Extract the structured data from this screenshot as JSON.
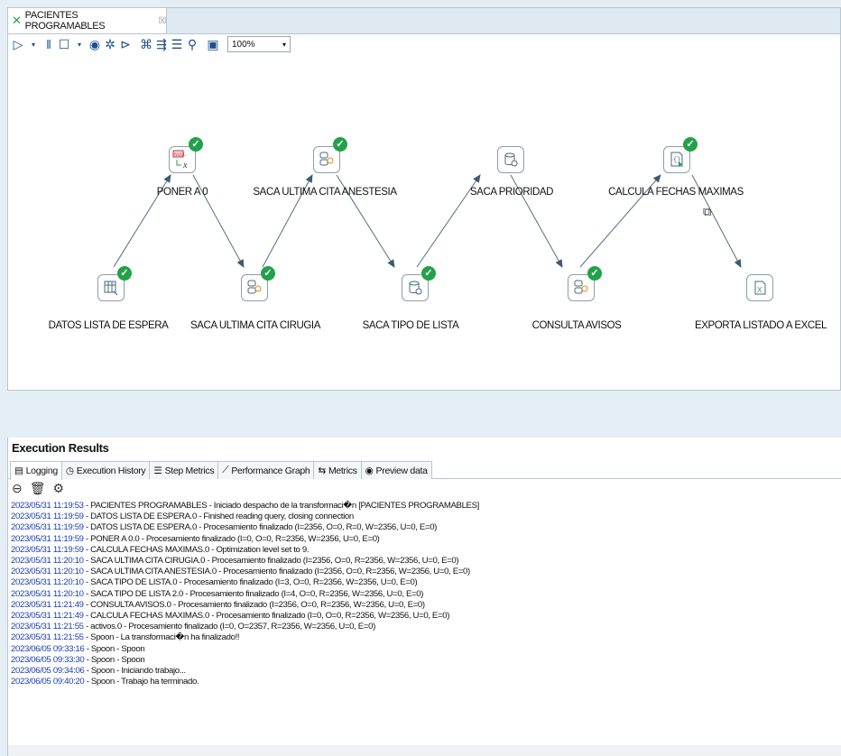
{
  "tab": {
    "title": "PACIENTES PROGRAMABLES",
    "close": "☒",
    "icon": "transformation-icon"
  },
  "toolbar": {
    "zoom": "100%"
  },
  "steps": {
    "datos_lista": "DATOS LISTA DE ESPERA",
    "poner_a0": "PONER A 0",
    "cita_cirugia": "SACA ULTIMA CITA CIRUGIA",
    "cita_anestesia": "SACA ULTIMA CITA ANESTESIA",
    "tipo_lista": "SACA TIPO DE LISTA",
    "prioridad": "SACA PRIORIDAD",
    "consulta_avisos": "CONSULTA AVISOS",
    "fechas_maximas": "CALCULA FECHAS MAXIMAS",
    "exporta_excel": "EXPORTA LISTADO A EXCEL"
  },
  "colors": {
    "success": "#23a14a",
    "timestamp": "#1a3fb0",
    "hop": "#3d5a72"
  },
  "results": {
    "title": "Execution Results",
    "tabs": [
      "Logging",
      "Execution History",
      "Step Metrics",
      "Performance Graph",
      "Metrics",
      "Preview data"
    ]
  },
  "log": [
    {
      "ts": "2023/05/31 11:19:53",
      "msg": " - PACIENTES PROGRAMABLES - Iniciado despacho de la transformaci�n [PACIENTES PROGRAMABLES]"
    },
    {
      "ts": "2023/05/31 11:19:59",
      "msg": " - DATOS LISTA DE ESPERA.0 - Finished reading query, closing connection"
    },
    {
      "ts": "2023/05/31 11:19:59",
      "msg": " - DATOS LISTA DE ESPERA.0 - Procesamiento finalizado (I=2356, O=0, R=0, W=2356, U=0, E=0)"
    },
    {
      "ts": "2023/05/31 11:19:59",
      "msg": " - PONER A 0.0 - Procesamiento finalizado (I=0, O=0, R=2356, W=2356, U=0, E=0)"
    },
    {
      "ts": "2023/05/31 11:19:59",
      "msg": " - CALCULA FECHAS MAXIMAS.0 - Optimization level set to 9."
    },
    {
      "ts": "2023/05/31 11:20:10",
      "msg": " - SACA ULTIMA CITA CIRUGIA.0 - Procesamiento finalizado (I=2356, O=0, R=2356, W=2356, U=0, E=0)"
    },
    {
      "ts": "2023/05/31 11:20:10",
      "msg": " - SACA ULTIMA CITA ANESTESIA.0 - Procesamiento finalizado (I=2356, O=0, R=2356, W=2356, U=0, E=0)"
    },
    {
      "ts": "2023/05/31 11:20:10",
      "msg": " - SACA TIPO DE LISTA.0 - Procesamiento finalizado (I=3, O=0, R=2356, W=2356, U=0, E=0)"
    },
    {
      "ts": "2023/05/31 11:20:10",
      "msg": " - SACA TIPO DE LISTA 2.0 - Procesamiento finalizado (I=4, O=0, R=2356, W=2356, U=0, E=0)"
    },
    {
      "ts": "2023/05/31 11:21:49",
      "msg": " - CONSULTA AVISOS.0 - Procesamiento finalizado (I=2356, O=0, R=2356, W=2356, U=0, E=0)"
    },
    {
      "ts": "2023/05/31 11:21:49",
      "msg": " - CALCULA FECHAS MAXIMAS.0 - Procesamiento finalizado (I=0, O=0, R=2356, W=2356, U=0, E=0)"
    },
    {
      "ts": "2023/05/31 11:21:55",
      "msg": " - activos.0 - Procesamiento finalizado (I=0, O=2357, R=2356, W=2356, U=0, E=0)"
    },
    {
      "ts": "2023/05/31 11:21:55",
      "msg": " - Spoon - La transformaci�n ha finalizado!!"
    },
    {
      "ts": "2023/06/05 09:33:16",
      "msg": " - Spoon - Spoon"
    },
    {
      "ts": "2023/06/05 09:33:30",
      "msg": " - Spoon - Spoon"
    },
    {
      "ts": "2023/06/05 09:34:06",
      "msg": " - Spoon - Iniciando trabajo..."
    },
    {
      "ts": "2023/06/05 09:40:20",
      "msg": " - Spoon - Trabajo ha terminado."
    }
  ]
}
